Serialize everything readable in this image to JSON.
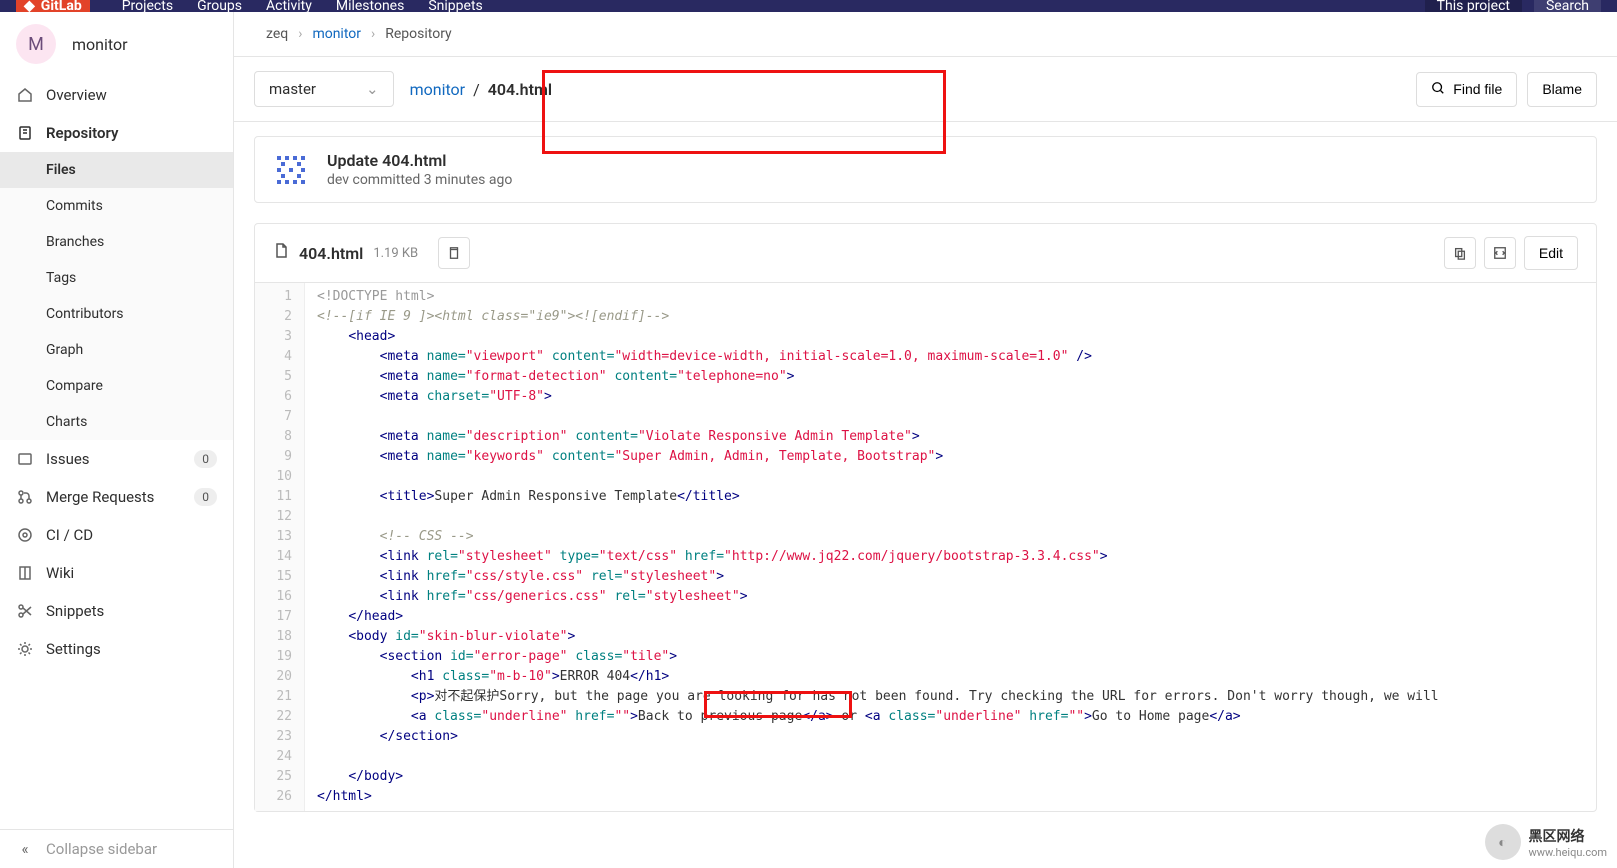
{
  "topbar": {
    "logo_text": "GitLab",
    "nav": [
      "Projects",
      "Groups",
      "Activity",
      "Milestones",
      "Snippets"
    ],
    "search_scope": "This project",
    "search_placeholder": "Search"
  },
  "project": {
    "avatar_letter": "M",
    "name": "monitor"
  },
  "sidebar": {
    "items": [
      {
        "icon": "home",
        "label": "Overview"
      },
      {
        "icon": "doc",
        "label": "Repository",
        "active": true
      },
      {
        "icon": "issues",
        "label": "Issues",
        "badge": "0"
      },
      {
        "icon": "merge",
        "label": "Merge Requests",
        "badge": "0"
      },
      {
        "icon": "ci",
        "label": "CI / CD"
      },
      {
        "icon": "wiki",
        "label": "Wiki"
      },
      {
        "icon": "snippets",
        "label": "Snippets"
      },
      {
        "icon": "settings",
        "label": "Settings"
      }
    ],
    "subnav": [
      {
        "label": "Files",
        "active": true
      },
      {
        "label": "Commits"
      },
      {
        "label": "Branches"
      },
      {
        "label": "Tags"
      },
      {
        "label": "Contributors"
      },
      {
        "label": "Graph"
      },
      {
        "label": "Compare"
      },
      {
        "label": "Charts"
      }
    ],
    "collapse": "Collapse sidebar"
  },
  "breadcrumb": {
    "root": "zeq",
    "project": "monitor",
    "section": "Repository"
  },
  "file_nav": {
    "branch": "master",
    "path_dir": "monitor",
    "path_file": "404.html",
    "find_file": "Find file",
    "blame": "Blame"
  },
  "commit": {
    "title": "Update 404.html",
    "meta": "dev committed 3 minutes ago"
  },
  "file": {
    "name": "404.html",
    "size": "1.19 KB",
    "edit": "Edit"
  },
  "code_html": [
    "<span class='tok-doctype'>&lt;!DOCTYPE html&gt;</span>",
    "<span class='tok-comment'>&lt;!--[if IE 9 ]&gt;&lt;html class=\"ie9\"&gt;&lt;![endif]--&gt;</span>",
    "    <span class='tok-tag'>&lt;head&gt;</span>",
    "        <span class='tok-tag'>&lt;meta</span> <span class='tok-attr'>name=</span><span class='tok-str'>\"viewport\"</span> <span class='tok-attr'>content=</span><span class='tok-str'>\"width=device-width, initial-scale=1.0, maximum-scale=1.0\"</span> <span class='tok-tag'>/&gt;</span>",
    "        <span class='tok-tag'>&lt;meta</span> <span class='tok-attr'>name=</span><span class='tok-str'>\"format-detection\"</span> <span class='tok-attr'>content=</span><span class='tok-str'>\"telephone=no\"</span><span class='tok-tag'>&gt;</span>",
    "        <span class='tok-tag'>&lt;meta</span> <span class='tok-attr'>charset=</span><span class='tok-str'>\"UTF-8\"</span><span class='tok-tag'>&gt;</span>",
    "",
    "        <span class='tok-tag'>&lt;meta</span> <span class='tok-attr'>name=</span><span class='tok-str'>\"description\"</span> <span class='tok-attr'>content=</span><span class='tok-str'>\"Violate Responsive Admin Template\"</span><span class='tok-tag'>&gt;</span>",
    "        <span class='tok-tag'>&lt;meta</span> <span class='tok-attr'>name=</span><span class='tok-str'>\"keywords\"</span> <span class='tok-attr'>content=</span><span class='tok-str'>\"Super Admin, Admin, Template, Bootstrap\"</span><span class='tok-tag'>&gt;</span>",
    "",
    "        <span class='tok-tag'>&lt;title&gt;</span><span class='tok-text'>Super Admin Responsive Template</span><span class='tok-tag'>&lt;/title&gt;</span>",
    "",
    "        <span class='tok-comment'>&lt;!-- CSS --&gt;</span>",
    "        <span class='tok-tag'>&lt;link</span> <span class='tok-attr'>rel=</span><span class='tok-str'>\"stylesheet\"</span> <span class='tok-attr'>type=</span><span class='tok-str'>\"text/css\"</span> <span class='tok-attr'>href=</span><span class='tok-str'>\"http://www.jq22.com/jquery/bootstrap-3.3.4.css\"</span><span class='tok-tag'>&gt;</span>",
    "        <span class='tok-tag'>&lt;link</span> <span class='tok-attr'>href=</span><span class='tok-str'>\"css/style.css\"</span> <span class='tok-attr'>rel=</span><span class='tok-str'>\"stylesheet\"</span><span class='tok-tag'>&gt;</span>",
    "        <span class='tok-tag'>&lt;link</span> <span class='tok-attr'>href=</span><span class='tok-str'>\"css/generics.css\"</span> <span class='tok-attr'>rel=</span><span class='tok-str'>\"stylesheet\"</span><span class='tok-tag'>&gt;</span>",
    "    <span class='tok-tag'>&lt;/head&gt;</span>",
    "    <span class='tok-tag'>&lt;body</span> <span class='tok-attr'>id=</span><span class='tok-str'>\"skin-blur-violate\"</span><span class='tok-tag'>&gt;</span>",
    "        <span class='tok-tag'>&lt;section</span> <span class='tok-attr'>id=</span><span class='tok-str'>\"error-page\"</span> <span class='tok-attr'>class=</span><span class='tok-str'>\"tile\"</span><span class='tok-tag'>&gt;</span>",
    "            <span class='tok-tag'>&lt;h1</span> <span class='tok-attr'>class=</span><span class='tok-str'>\"m-b-10\"</span><span class='tok-tag'>&gt;</span><span class='tok-text'>ERROR 404</span><span class='tok-tag'>&lt;/h1&gt;</span>",
    "            <span class='tok-tag'>&lt;p&gt;</span><span class='tok-text'>对不起保护Sorry, but the page you are looking for has not been found. Try checking the URL for errors. Don't worry though, we will</span>",
    "            <span class='tok-tag'>&lt;a</span> <span class='tok-attr'>class=</span><span class='tok-str'>\"underline\"</span> <span class='tok-attr'>href=</span><span class='tok-str'>\"\"</span><span class='tok-tag'>&gt;</span><span class='tok-text'>Back to previous page</span><span class='tok-tag'>&lt;/a&gt;</span><span class='tok-text'> or </span><span class='tok-tag'>&lt;a</span> <span class='tok-attr'>class=</span><span class='tok-str'>\"underline\"</span> <span class='tok-attr'>href=</span><span class='tok-str'>\"\"</span><span class='tok-tag'>&gt;</span><span class='tok-text'>Go to Home page</span><span class='tok-tag'>&lt;/a&gt;</span>",
    "        <span class='tok-tag'>&lt;/section&gt;</span>",
    "",
    "    <span class='tok-tag'>&lt;/body&gt;</span>",
    "<span class='tok-tag'>&lt;/html&gt;</span>"
  ],
  "watermark": {
    "title": "黑区网络",
    "url": "www.heiqu.com"
  }
}
